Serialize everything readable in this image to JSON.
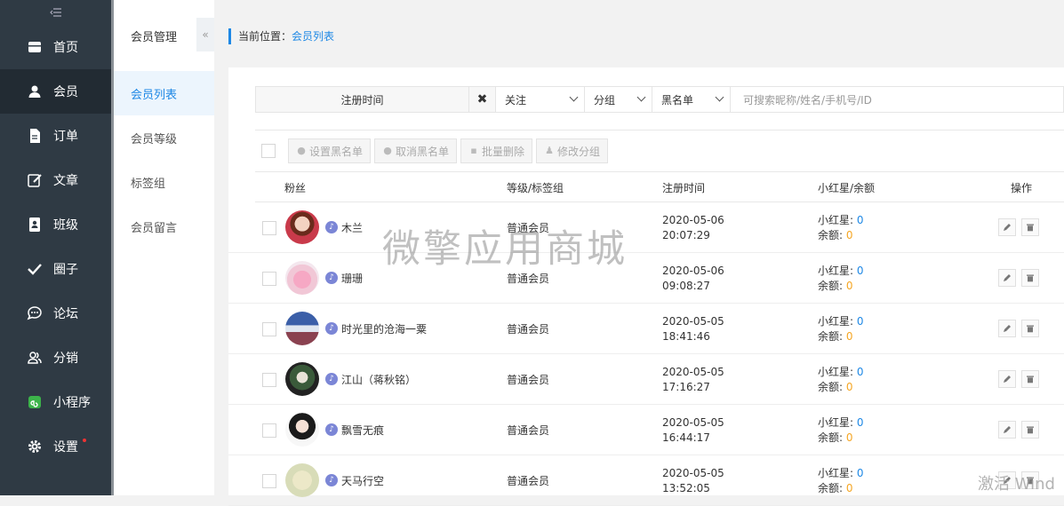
{
  "sidebar": {
    "items": [
      {
        "label": "首页",
        "icon": "store-icon",
        "active": false
      },
      {
        "label": "会员",
        "icon": "user-icon",
        "active": true
      },
      {
        "label": "订单",
        "icon": "document-icon",
        "active": false
      },
      {
        "label": "文章",
        "icon": "edit-icon",
        "active": false
      },
      {
        "label": "班级",
        "icon": "class-icon",
        "active": false
      },
      {
        "label": "圈子",
        "icon": "check-icon",
        "active": false
      },
      {
        "label": "论坛",
        "icon": "chat-icon",
        "active": false
      },
      {
        "label": "分销",
        "icon": "group-icon",
        "active": false
      },
      {
        "label": "小程序",
        "icon": "miniprogram-icon",
        "active": false
      },
      {
        "label": "设置",
        "icon": "gear-icon",
        "active": false
      }
    ]
  },
  "subnav": {
    "title": "会员管理",
    "items": [
      {
        "label": "会员列表",
        "active": true
      },
      {
        "label": "会员等级",
        "active": false
      },
      {
        "label": "标签组",
        "active": false
      },
      {
        "label": "会员留言",
        "active": false
      }
    ],
    "fold_icon": "«"
  },
  "breadcrumb": {
    "prefix": "当前位置：",
    "current": "会员列表"
  },
  "filters": {
    "date_label": "注册时间",
    "clear_glyph": "✖",
    "follow": "关注",
    "group": "分组",
    "blacklist": "黑名单",
    "search_placeholder": "可搜索昵称/姓名/手机号/ID"
  },
  "actions": {
    "set_blacklist": "设置黑名单",
    "cancel_blacklist": "取消黑名单",
    "batch_delete": "批量删除",
    "change_group": "修改分组"
  },
  "table": {
    "headers": {
      "fans": "粉丝",
      "level": "等级/标签组",
      "regtime": "注册时间",
      "balance": "小红星/余额",
      "ops": "操作"
    },
    "star_label": "小红星:",
    "balance_label": "余额:",
    "rows": [
      {
        "name": "木兰",
        "level": "普通会员",
        "date": "2020-05-06",
        "time": "20:07:29",
        "stars": "0",
        "balance": "0"
      },
      {
        "name": "珊珊",
        "level": "普通会员",
        "date": "2020-05-06",
        "time": "09:08:27",
        "stars": "0",
        "balance": "0"
      },
      {
        "name": "时光里的沧海一粟",
        "level": "普通会员",
        "date": "2020-05-05",
        "time": "18:41:46",
        "stars": "0",
        "balance": "0"
      },
      {
        "name": "江山（蒋秋铭）",
        "level": "普通会员",
        "date": "2020-05-05",
        "time": "17:16:27",
        "stars": "0",
        "balance": "0"
      },
      {
        "name": "飘雪无痕",
        "level": "普通会员",
        "date": "2020-05-05",
        "time": "16:44:17",
        "stars": "0",
        "balance": "0"
      },
      {
        "name": "天马行空",
        "level": "普通会员",
        "date": "2020-05-05",
        "time": "13:52:05",
        "stars": "0",
        "balance": "0"
      }
    ]
  },
  "watermark": "微擎应用商城",
  "windows_mark": "激活 Wind",
  "colors": {
    "sidebar": "#2f3a44",
    "accent": "#1e88e5",
    "balance": "#f5a623"
  }
}
